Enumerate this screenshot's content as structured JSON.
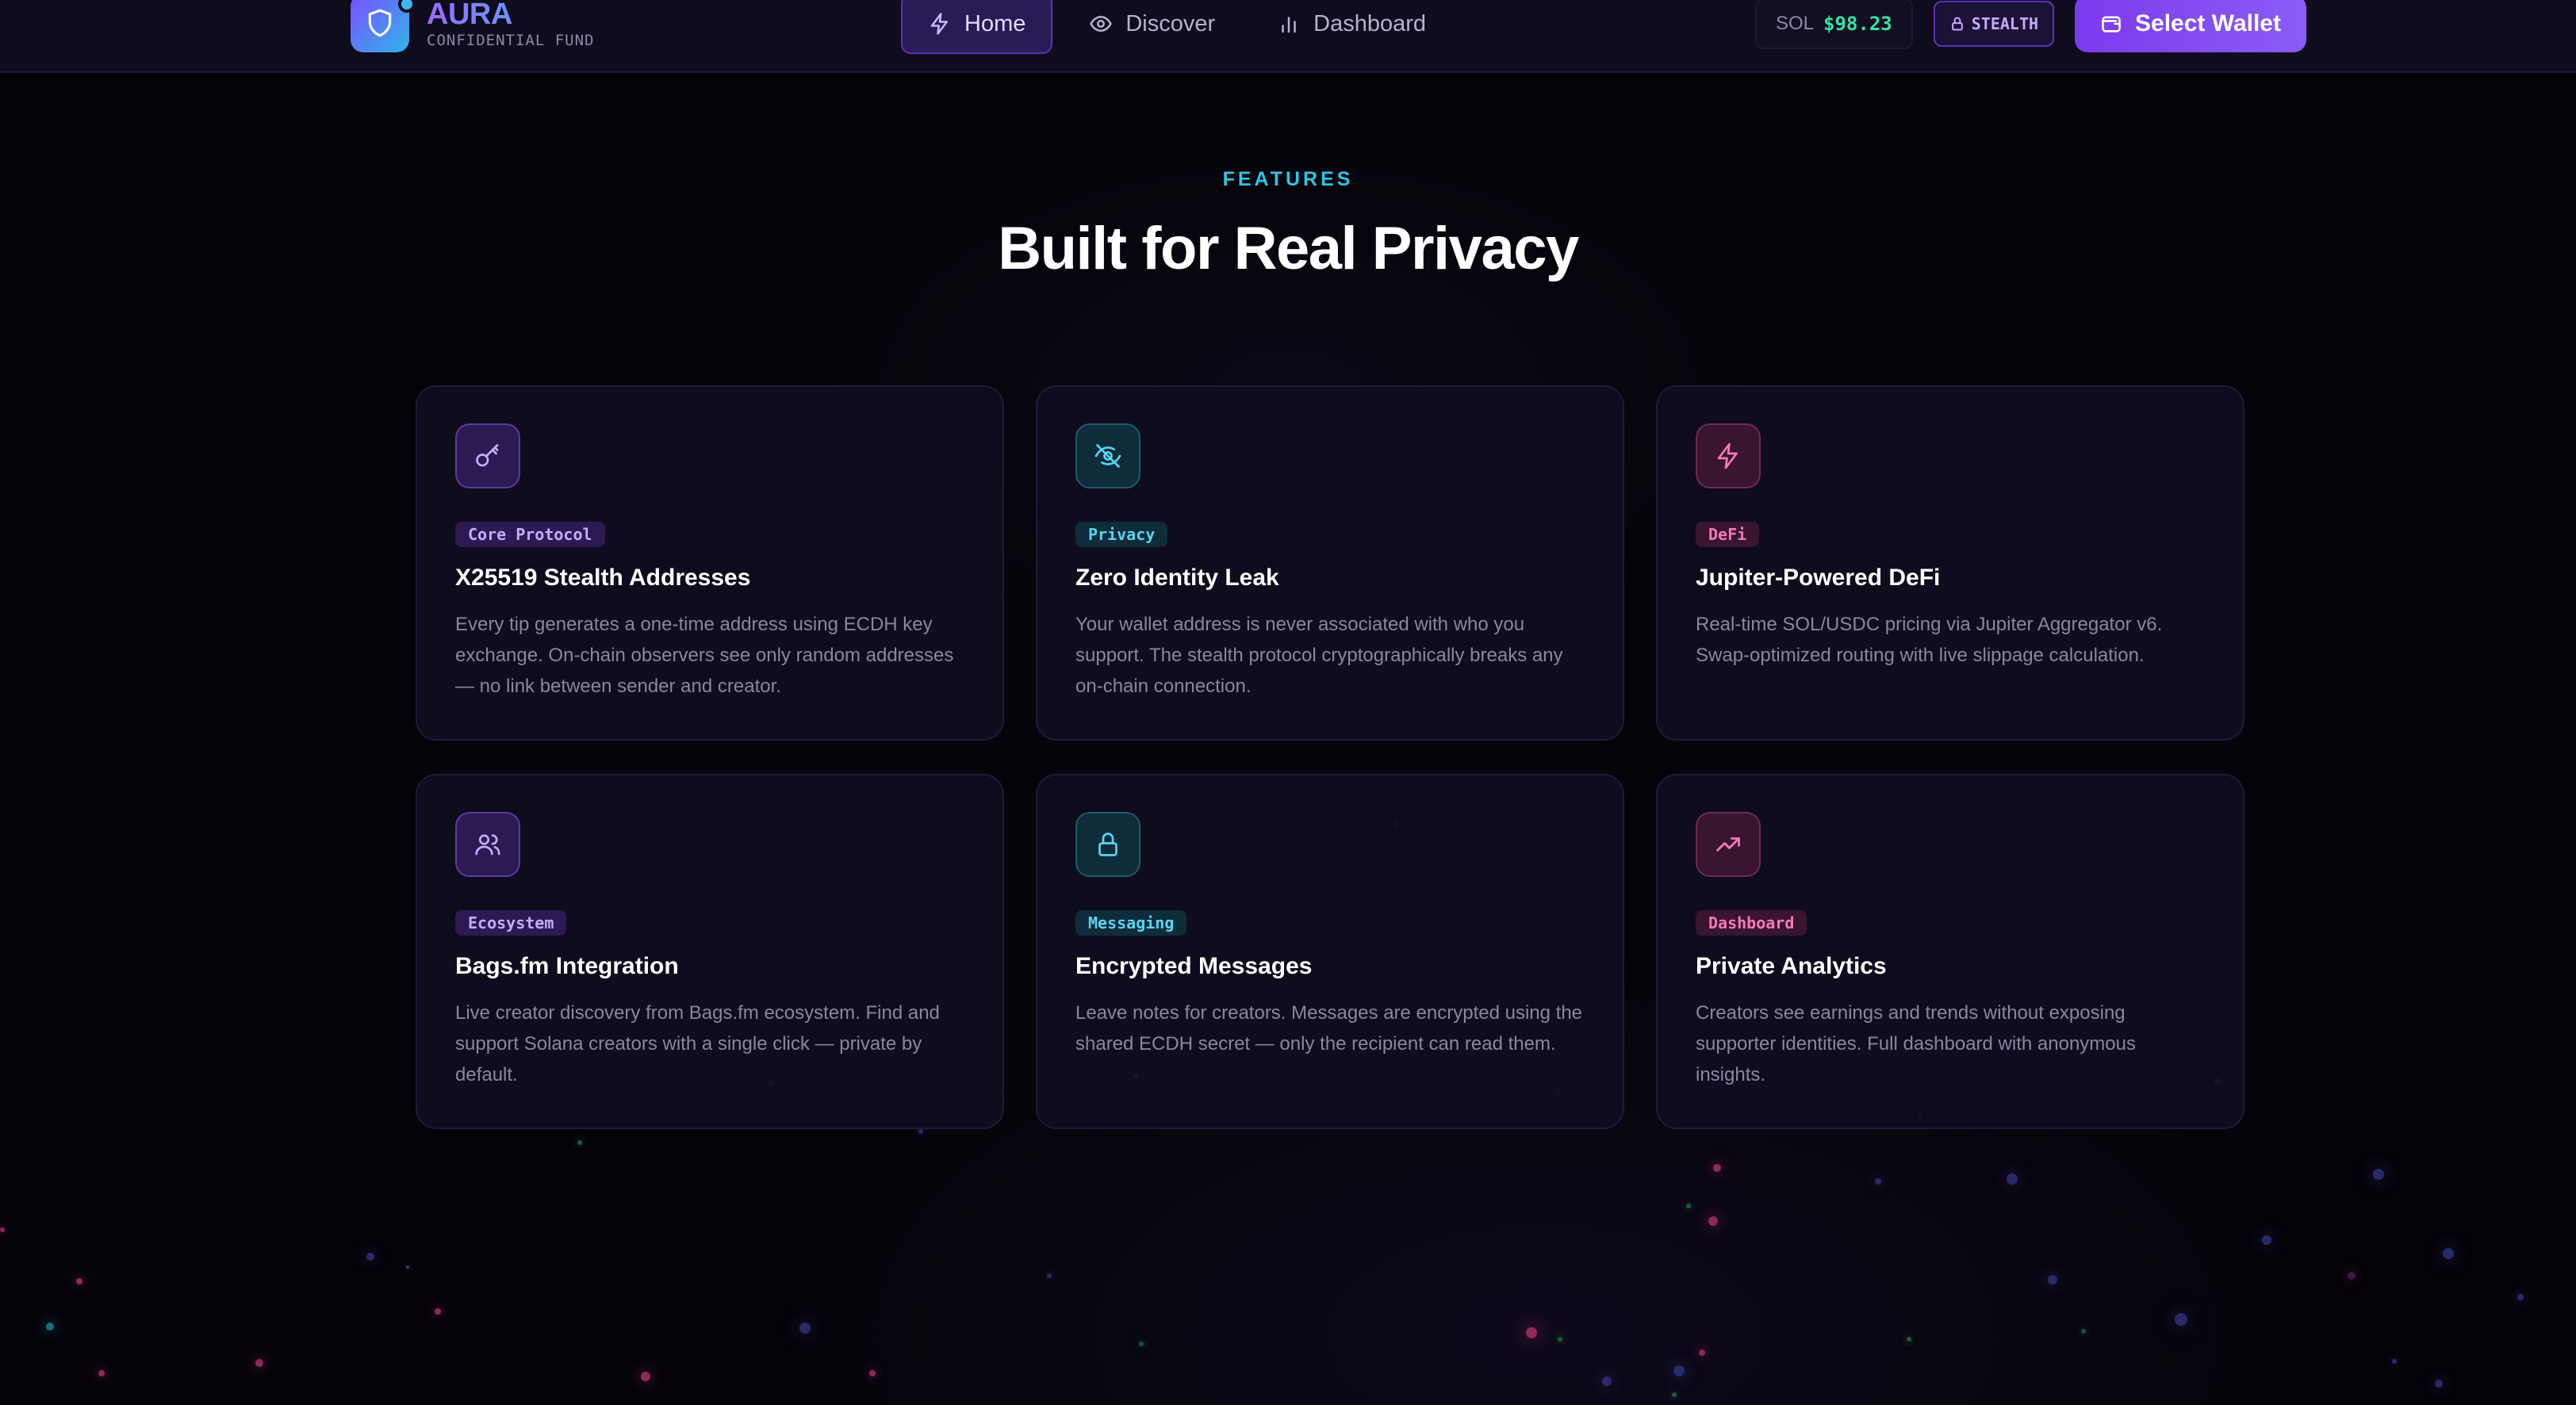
{
  "header": {
    "logo_title": "AURA",
    "logo_subtitle": "CONFIDENTIAL FUND",
    "nav": [
      {
        "label": "Home",
        "icon": "bolt-icon",
        "active": true
      },
      {
        "label": "Discover",
        "icon": "eye-icon",
        "active": false
      },
      {
        "label": "Dashboard",
        "icon": "bar-chart-icon",
        "active": false
      }
    ],
    "price_symbol": "SOL",
    "price_value": "$98.23",
    "stealth_label": "STEALTH",
    "wallet_button": "Select Wallet"
  },
  "features": {
    "eyebrow": "FEATURES",
    "title": "Built for Real Privacy",
    "cards": [
      {
        "tag": "Core Protocol",
        "title": "X25519 Stealth Addresses",
        "desc": "Every tip generates a one-time address using ECDH key exchange. On-chain observers see only random addresses — no link between sender and creator.",
        "icon": "key-icon",
        "accent": "purple"
      },
      {
        "tag": "Privacy",
        "title": "Zero Identity Leak",
        "desc": "Your wallet address is never associated with who you support. The stealth protocol cryptographically breaks any on-chain connection.",
        "icon": "eye-off-icon",
        "accent": "cyan"
      },
      {
        "tag": "DeFi",
        "title": "Jupiter-Powered DeFi",
        "desc": "Real-time SOL/USDC pricing via Jupiter Aggregator v6. Swap-optimized routing with live slippage calculation.",
        "icon": "bolt-icon",
        "accent": "pink"
      },
      {
        "tag": "Ecosystem",
        "title": "Bags.fm Integration",
        "desc": "Live creator discovery from Bags.fm ecosystem. Find and support Solana creators with a single click — private by default.",
        "icon": "users-icon",
        "accent": "purple"
      },
      {
        "tag": "Messaging",
        "title": "Encrypted Messages",
        "desc": "Leave notes for creators. Messages are encrypted using the shared ECDH secret — only the recipient can read them.",
        "icon": "lock-icon",
        "accent": "cyan"
      },
      {
        "tag": "Dashboard",
        "title": "Private Analytics",
        "desc": "Creators see earnings and trends without exposing supporter identities. Full dashboard with anonymous insights.",
        "icon": "trending-up-icon",
        "accent": "pink"
      }
    ]
  },
  "colors": {
    "background": "#050309",
    "accent_purple": "#8b5cf6",
    "accent_cyan": "#2ec4e6",
    "accent_pink": "#f37bb8",
    "price_green": "#34e3a0"
  }
}
